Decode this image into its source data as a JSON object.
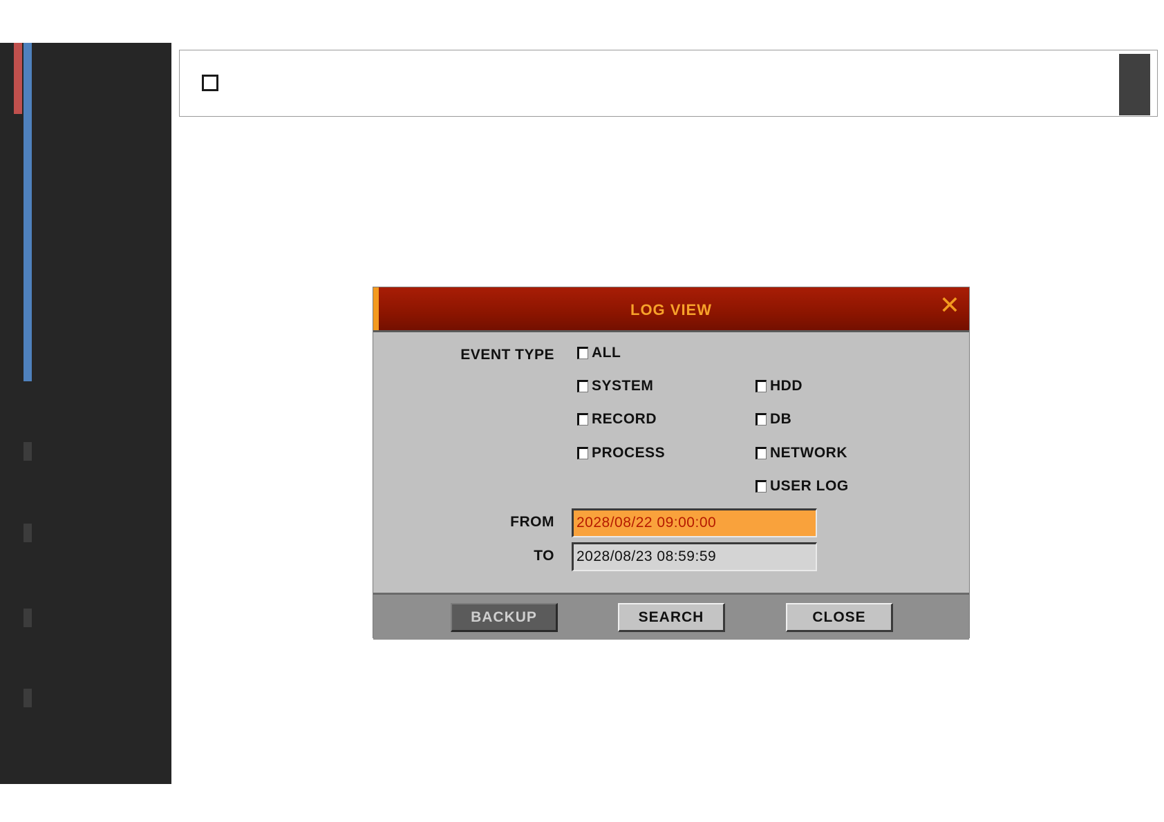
{
  "dialog": {
    "title": "LOG VIEW",
    "close_icon": "close-icon",
    "event_type_label": "EVENT TYPE",
    "checkboxes": {
      "all": "ALL",
      "system": "SYSTEM",
      "hdd": "HDD",
      "record": "RECORD",
      "db": "DB",
      "process": "PROCESS",
      "network": "NETWORK",
      "user_log": "USER LOG"
    },
    "from_label": "FROM",
    "from_value": "2028/08/22 09:00:00",
    "to_label": "TO",
    "to_value": "2028/08/23 08:59:59",
    "buttons": {
      "backup": "BACKUP",
      "search": "SEARCH",
      "close": "CLOSE"
    }
  },
  "colors": {
    "title_bar": "#8c1500",
    "title_text": "#f7a22a",
    "active_field": "#f9a23c",
    "sidebar": "#262626",
    "sidebar_red": "#c0504d",
    "sidebar_blue": "#4f81bd"
  }
}
